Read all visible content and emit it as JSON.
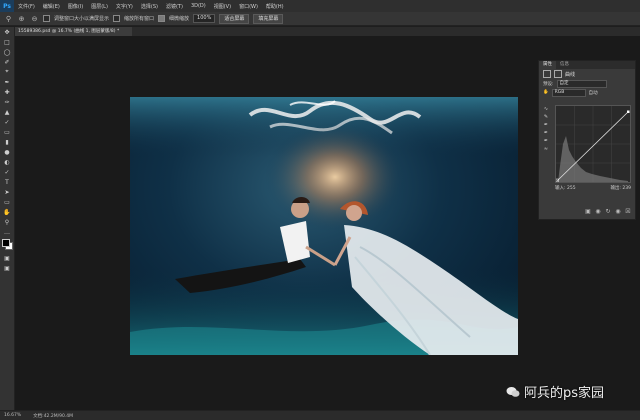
{
  "app": {
    "logo": "Ps"
  },
  "menu": [
    "文件(F)",
    "编辑(E)",
    "图像(I)",
    "图层(L)",
    "文字(Y)",
    "选择(S)",
    "滤镜(T)",
    "3D(D)",
    "视图(V)",
    "窗口(W)",
    "帮助(H)"
  ],
  "options": {
    "resize_windows_label": "调整窗口大小以满屏显示",
    "zoom_all_label": "缩放所有窗口",
    "scrubby_zoom_label": "细微缩放",
    "zoom_value": "100%",
    "fit_screen_label": "适合屏幕",
    "fill_screen_label": "填充屏幕"
  },
  "document": {
    "tab_title": "15589386.psd @ 16.7% (曲线 1, 图层蒙版/8) *"
  },
  "panel": {
    "tabs": [
      "属性",
      "信息"
    ],
    "title": "曲线",
    "preset_label": "预设:",
    "preset_value": "自定",
    "channel_value": "RGB",
    "auto_label": "自动",
    "input_label": "输入:",
    "input_value": "255",
    "output_label": "输出:",
    "output_value": "239"
  },
  "status": {
    "zoom": "16.67%",
    "doc_size": "文档:42.2M/90.4M"
  },
  "watermark": {
    "text": "阿兵的ps家园"
  },
  "colors": {
    "accent": "#31a8ff",
    "water_dark": "#06192a",
    "water_teal": "#1a7f86"
  }
}
